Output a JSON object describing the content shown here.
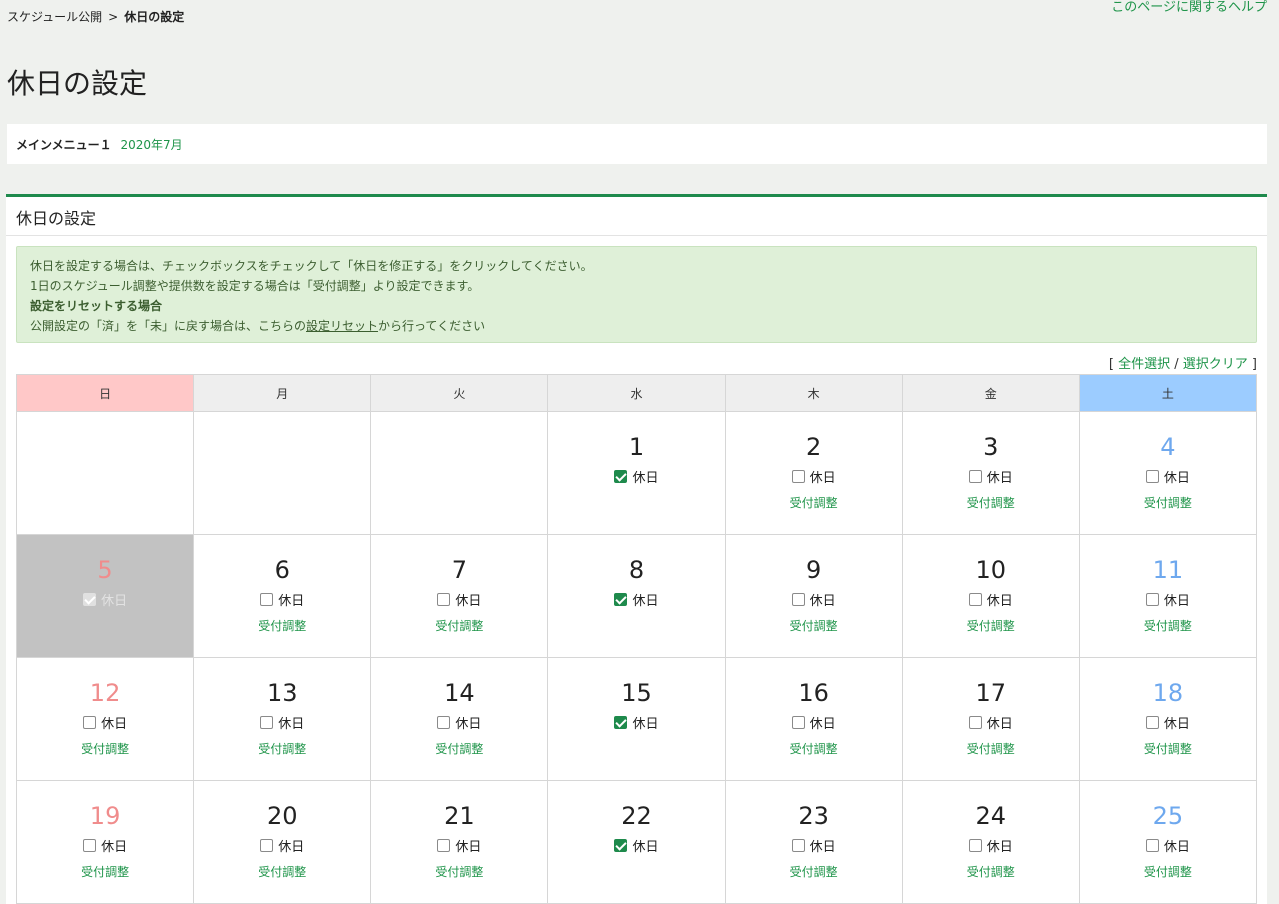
{
  "breadcrumb": {
    "parent": "スケジュール公開",
    "separator": ">",
    "current": "休日の設定"
  },
  "help_link": "このページに関するヘルプ",
  "page_title": "休日の設定",
  "menu": {
    "name": "メインメニュー１",
    "date": "2020年7月"
  },
  "panel_title": "休日の設定",
  "notice": {
    "line1": "休日を設定する場合は、チェックボックスをチェックして「休日を修正する」をクリックしてください。",
    "line2": "1日のスケジュール調整や提供数を設定する場合は「受付調整」より設定できます。",
    "line3": "設定をリセットする場合",
    "line4_before": "公開設定の「済」を「未」に戻す場合は、こちらの",
    "line4_link": "設定リセット",
    "line4_after": "から行ってください"
  },
  "select": {
    "open": "[",
    "select_all": "全件選択",
    "slash": "/",
    "clear": "選択クリア",
    "close": "]"
  },
  "weekdays": [
    "日",
    "月",
    "火",
    "水",
    "木",
    "金",
    "土"
  ],
  "holiday_label": "休日",
  "adjust_label": "受付調整",
  "weeks": [
    [
      null,
      null,
      null,
      {
        "day": "1",
        "checked": true,
        "adjust": false
      },
      {
        "day": "2",
        "checked": false,
        "adjust": true
      },
      {
        "day": "3",
        "checked": false,
        "adjust": true
      },
      {
        "day": "4",
        "checked": false,
        "adjust": true
      }
    ],
    [
      {
        "day": "5",
        "checked": true,
        "adjust": false,
        "past": true
      },
      {
        "day": "6",
        "checked": false,
        "adjust": true
      },
      {
        "day": "7",
        "checked": false,
        "adjust": true
      },
      {
        "day": "8",
        "checked": true,
        "adjust": false
      },
      {
        "day": "9",
        "checked": false,
        "adjust": true
      },
      {
        "day": "10",
        "checked": false,
        "adjust": true
      },
      {
        "day": "11",
        "checked": false,
        "adjust": true
      }
    ],
    [
      {
        "day": "12",
        "checked": false,
        "adjust": true
      },
      {
        "day": "13",
        "checked": false,
        "adjust": true
      },
      {
        "day": "14",
        "checked": false,
        "adjust": true
      },
      {
        "day": "15",
        "checked": true,
        "adjust": false
      },
      {
        "day": "16",
        "checked": false,
        "adjust": true
      },
      {
        "day": "17",
        "checked": false,
        "adjust": true
      },
      {
        "day": "18",
        "checked": false,
        "adjust": true
      }
    ],
    [
      {
        "day": "19",
        "checked": false,
        "adjust": true
      },
      {
        "day": "20",
        "checked": false,
        "adjust": true
      },
      {
        "day": "21",
        "checked": false,
        "adjust": true
      },
      {
        "day": "22",
        "checked": true,
        "adjust": false
      },
      {
        "day": "23",
        "checked": false,
        "adjust": true
      },
      {
        "day": "24",
        "checked": false,
        "adjust": true
      },
      {
        "day": "25",
        "checked": false,
        "adjust": true
      }
    ]
  ]
}
